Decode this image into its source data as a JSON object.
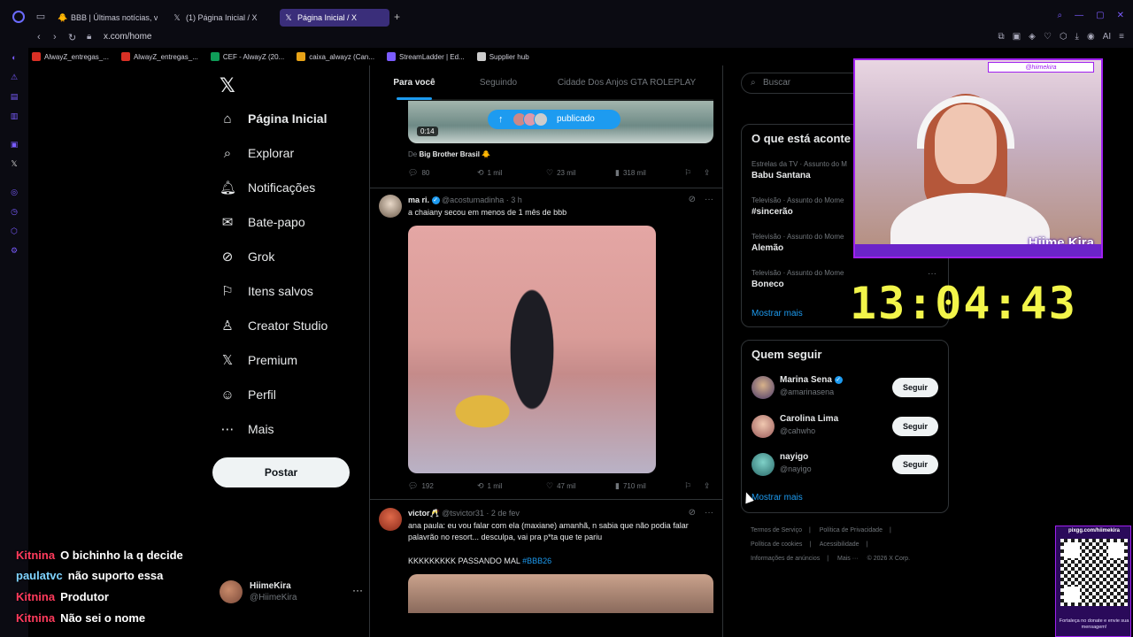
{
  "browser": {
    "tabs": [
      {
        "label": "BBB | Últimas notícias, vid",
        "icon": "bbb-icon"
      },
      {
        "label": "(1) Página Inicial / X",
        "icon": "x-icon"
      },
      {
        "label": "Página Inicial / X",
        "icon": "x-icon",
        "active": true
      }
    ],
    "url": "x.com/home",
    "bookmarks": [
      {
        "label": "AlwayZ_entregas_...",
        "color": "#d93025"
      },
      {
        "label": "AlwayZ_entregas_...",
        "color": "#d93025"
      },
      {
        "label": "CEF - AlwayZ (20...",
        "color": "#0f9d58"
      },
      {
        "label": "caixa_alwayz (Can...",
        "color": "#e8a317"
      },
      {
        "label": "StreamLadder | Ed...",
        "color": "#7b5cff"
      },
      {
        "label": "Supplier hub",
        "color": "#cccccc"
      }
    ],
    "ai_label": "AI"
  },
  "nav": {
    "items": [
      {
        "label": "Página Inicial",
        "icon": "home-icon",
        "active": true
      },
      {
        "label": "Explorar",
        "icon": "search-icon"
      },
      {
        "label": "Notificações",
        "icon": "bell-icon"
      },
      {
        "label": "Bate-papo",
        "icon": "mail-icon"
      },
      {
        "label": "Grok",
        "icon": "grok-icon"
      },
      {
        "label": "Itens salvos",
        "icon": "bookmark-icon"
      },
      {
        "label": "Creator Studio",
        "icon": "creator-icon"
      },
      {
        "label": "Premium",
        "icon": "x-icon"
      },
      {
        "label": "Perfil",
        "icon": "person-icon"
      },
      {
        "label": "Mais",
        "icon": "more-circle-icon"
      }
    ],
    "post_label": "Postar",
    "account": {
      "name": "HiimeKira",
      "handle": "@HiimeKira"
    }
  },
  "timeline": {
    "tabs": [
      "Para você",
      "Seguindo",
      "Cidade Dos Anjos GTA ROLEPLAY"
    ],
    "video_time": "0:14",
    "published_label": "publicado",
    "source_prefix": "De",
    "source_name": "Big Brother Brasil 🐥",
    "tweet0_actions": {
      "replies": "80",
      "retweets": "1 mil",
      "likes": "23 mil",
      "views": "318 mil"
    },
    "tweet1": {
      "name": "ma ri.",
      "handle": "@acostumadinha",
      "time": "· 3 h",
      "text": "a chaiany secou em menos de 1 mês de bbb",
      "actions": {
        "replies": "192",
        "retweets": "1 mil",
        "likes": "47 mil",
        "views": "710 mil"
      }
    },
    "tweet2": {
      "name": "victor🥂",
      "handle": "@tsvictor31",
      "time": "· 2 de fev",
      "text1": "ana paula: eu vou falar com ela (maxiane) amanhã, n sabia que não podia falar palavrão no resort... desculpa, vai pra p*ta que te pariu",
      "text2": "KKKKKKKKK PASSANDO MAL",
      "hashtag": "#BBB26"
    }
  },
  "right": {
    "search_placeholder": "Buscar",
    "trends_title": "O que está aconte",
    "trends": [
      {
        "meta": "Estrelas da TV · Assunto do M",
        "name": "Babu Santana"
      },
      {
        "meta": "Televisão · Assunto do Mome",
        "name": "#sincerão"
      },
      {
        "meta": "Televisão · Assunto do Mome",
        "name": "Alemão"
      },
      {
        "meta": "Televisão · Assunto do Mome",
        "name": "Boneco"
      }
    ],
    "show_more": "Mostrar mais",
    "follow_title": "Quem seguir",
    "follow": [
      {
        "name": "Marina Sena",
        "handle": "@amarinasena",
        "verified": true,
        "button": "Seguir"
      },
      {
        "name": "Carolina Lima",
        "handle": "@cahwho",
        "verified": false,
        "button": "Seguir"
      },
      {
        "name": "nayigo",
        "handle": "@nayigo",
        "verified": false,
        "button": "Seguir"
      }
    ],
    "follow_more": "Mostrar mais",
    "footer": [
      "Termos de Serviço",
      "|",
      "Política de Privacidade",
      "|",
      "Política de cookies",
      "|",
      "Acessibilidade",
      "|",
      "Informações de anúncios",
      "|",
      "Mais ···",
      "© 2026 X Corp."
    ]
  },
  "stream": {
    "cam_handle": "@hiimekira",
    "cam_brand": "Hiime Kira",
    "clock": "13:04:43",
    "chat": [
      {
        "user": "Kitnina",
        "msg": "O bichinho la q decide",
        "color": "#ff3b5c"
      },
      {
        "user": "paulatvc",
        "msg": "não suporto essa",
        "color": "#7fd3ff"
      },
      {
        "user": "Kitnina",
        "msg": "Produtor",
        "color": "#ff3b5c"
      },
      {
        "user": "Kitnina",
        "msg": "Não sei o nome",
        "color": "#ff3b5c"
      }
    ],
    "qr_url": "pixgg.com/hiimekira",
    "qr_caption": "Fortaleça no donate e envie sua mensagem!"
  }
}
